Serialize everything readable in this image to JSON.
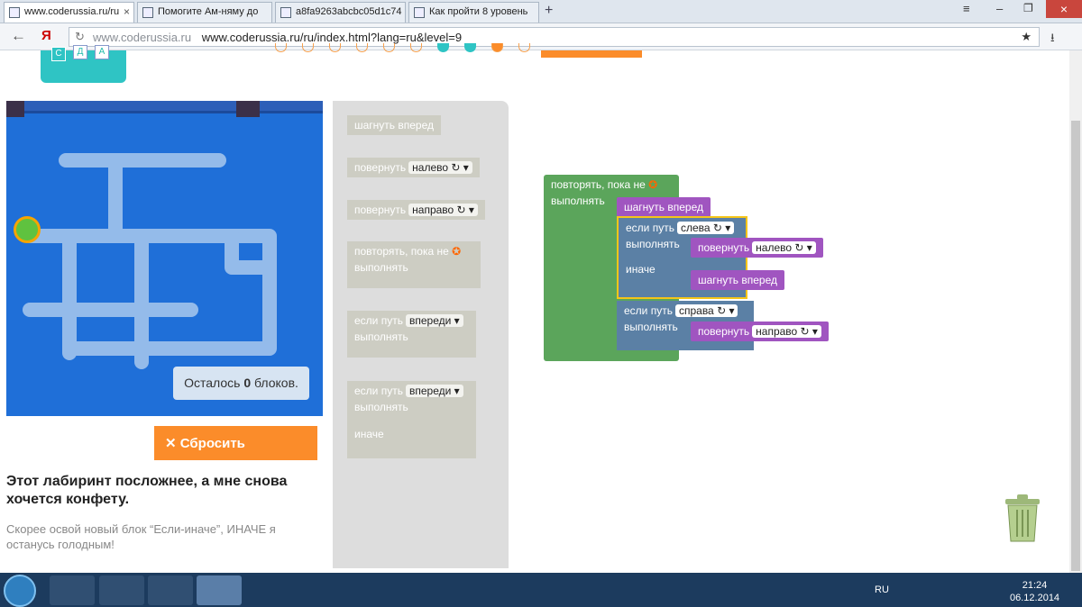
{
  "browser": {
    "tabs": [
      {
        "label": "www.coderussia.ru/ru",
        "active": true
      },
      {
        "label": "Помогите Ам-няму до",
        "active": false
      },
      {
        "label": "a8fa9263abcbc05d1c74",
        "active": false
      },
      {
        "label": "Как пройти 8 уровень",
        "active": false
      }
    ],
    "url_host": "www.coderussia.ru",
    "url_full": "www.coderussia.ru/ru/index.html?lang=ru&level=9"
  },
  "logo_letters": [
    "С",
    "Д",
    "А"
  ],
  "game": {
    "remaining_prefix": "Осталось ",
    "remaining_count": "0",
    "remaining_suffix": " блоков.",
    "reset_label": "Сбросить",
    "title": "Этот лабиринт посложнее, а мне снова хочется конфету.",
    "description": "Скорее освой новый блок “Если-иначе”, ИНАЧЕ я останусь голодным!"
  },
  "toolbox": {
    "move_forward": "шагнуть вперед",
    "turn": "повернуть",
    "left": "налево",
    "right": "направо",
    "repeat_until": "повторять, пока не",
    "do": "выполнять",
    "if_path": "если путь",
    "ahead": "впереди",
    "else": "иначе"
  },
  "workspace": {
    "repeat_until": "повторять, пока не",
    "do": "выполнять",
    "move_forward": "шагнуть вперед",
    "if_path": "если путь",
    "left_dir": "слева",
    "right_dir": "справа",
    "turn": "повернуть",
    "left": "налево",
    "right": "направо",
    "else": "иначе"
  },
  "taskbar": {
    "lang": "RU",
    "time": "21:24",
    "date": "06.12.2014"
  }
}
